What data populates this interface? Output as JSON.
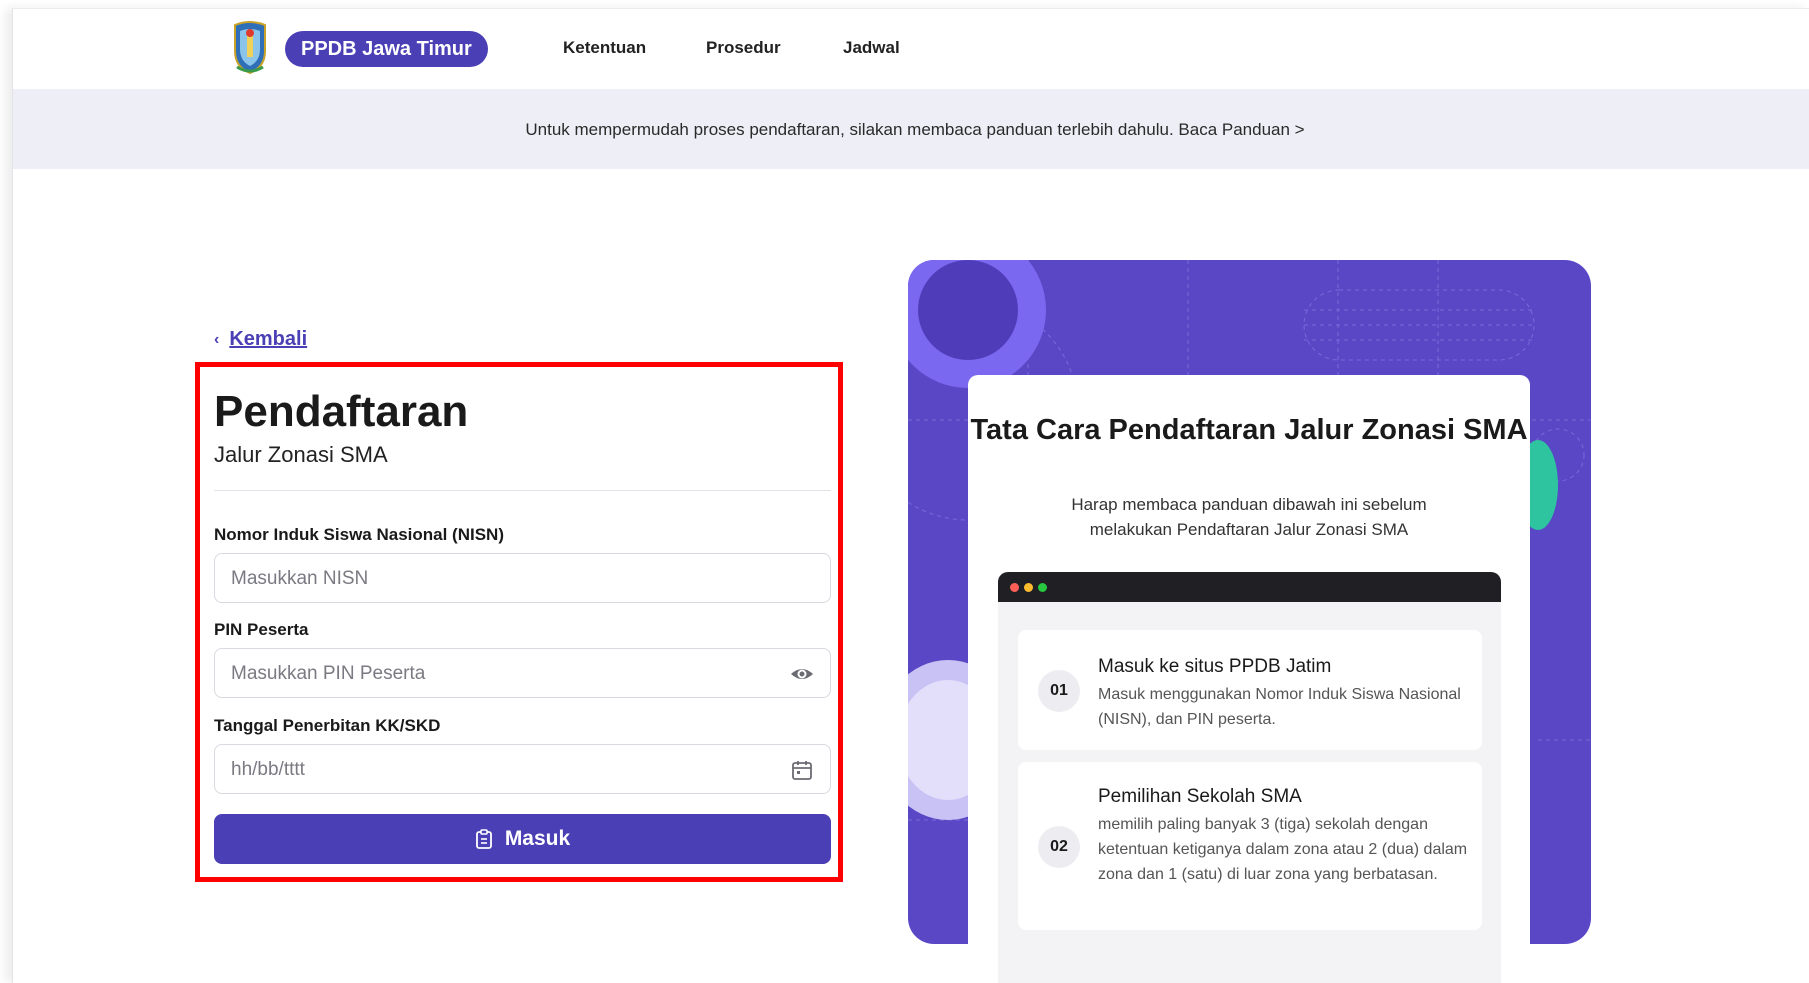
{
  "header": {
    "brand": "PPDB Jawa Timur",
    "nav": [
      "Ketentuan",
      "Prosedur",
      "Jadwal"
    ]
  },
  "banner": {
    "text": "Untuk mempermudah proses pendaftaran, silakan membaca panduan terlebih dahulu. Baca Panduan >"
  },
  "form": {
    "back_label": "Kembali",
    "title": "Pendaftaran",
    "subtitle": "Jalur Zonasi SMA",
    "nisn_label": "Nomor Induk Siswa Nasional (NISN)",
    "nisn_placeholder": "Masukkan NISN",
    "pin_label": "PIN Peserta",
    "pin_placeholder": "Masukkan PIN Peserta",
    "date_label": "Tanggal Penerbitan KK/SKD",
    "date_placeholder": "hh/bb/tttt",
    "submit_label": "Masuk"
  },
  "guide": {
    "title": "Tata Cara Pendaftaran Jalur Zonasi SMA",
    "description": "Harap membaca panduan dibawah ini sebelum melakukan Pendaftaran Jalur Zonasi SMA",
    "steps": [
      {
        "number": "01",
        "title": "Masuk ke situs PPDB Jatim",
        "body": "Masuk menggunakan Nomor Induk Siswa Nasional (NISN), dan PIN peserta."
      },
      {
        "number": "02",
        "title": "Pemilihan Sekolah SMA",
        "body": "memilih paling banyak 3 (tiga) sekolah dengan ketentuan ketiganya dalam zona atau 2 (dua) dalam zona dan 1 (satu) di luar zona yang berbatasan."
      }
    ]
  },
  "colors": {
    "primary": "#4b3fb5",
    "panel": "#5a47c6",
    "highlight": "#ff0000",
    "banner_bg": "#eeeef6"
  },
  "icons": [
    "emblem-logo",
    "chevron-left-icon",
    "eye-icon",
    "calendar-icon",
    "clipboard-icon"
  ]
}
